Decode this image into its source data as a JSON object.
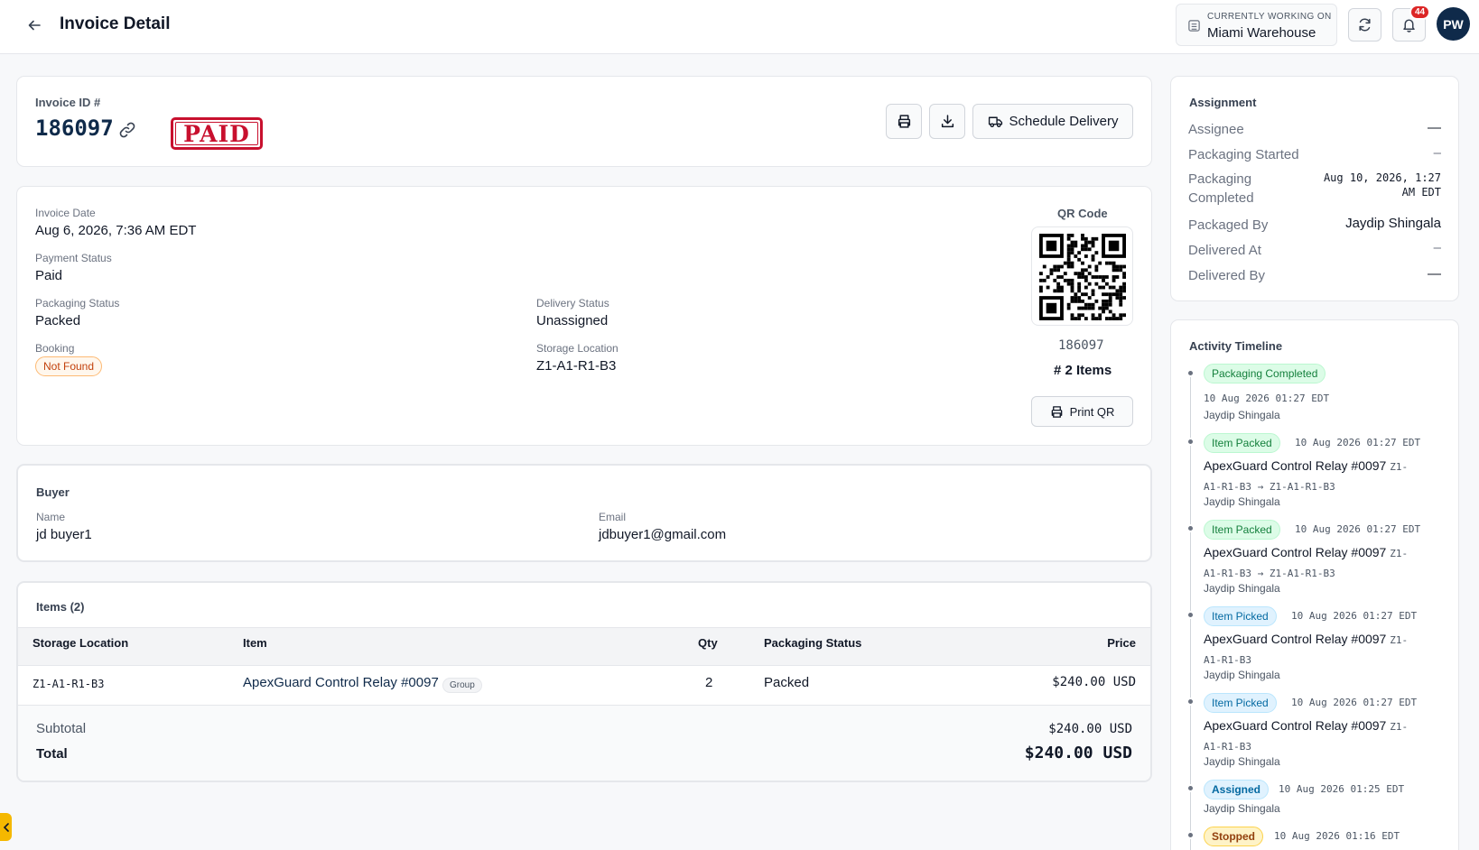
{
  "header": {
    "title": "Invoice Detail",
    "working_on_label": "CURRENTLY WORKING ON",
    "warehouse": "Miami Warehouse",
    "notif_count": "44",
    "avatar_initials": "PW"
  },
  "invoice": {
    "id_label": "Invoice ID #",
    "id": "186097",
    "stamp": "PAID",
    "schedule_delivery": "Schedule Delivery"
  },
  "details": {
    "invoice_date_label": "Invoice Date",
    "invoice_date": "Aug 6, 2026, 7:36 AM EDT",
    "payment_status_label": "Payment Status",
    "payment_status": "Paid",
    "packaging_status_label": "Packaging Status",
    "packaging_status": "Packed",
    "delivery_status_label": "Delivery Status",
    "delivery_status": "Unassigned",
    "booking_label": "Booking",
    "booking": "Not Found",
    "storage_location_label": "Storage Location",
    "storage_location": "Z1-A1-R1-B3",
    "qr_label": "QR Code",
    "qr_id": "186097",
    "items_count": "# 2 Items",
    "print_qr": "Print QR"
  },
  "buyer": {
    "title": "Buyer",
    "name_label": "Name",
    "name": "jd buyer1",
    "email_label": "Email",
    "email": "jdbuyer1@gmail.com"
  },
  "items": {
    "title": "Items (2)",
    "columns": [
      "Storage Location",
      "Item",
      "Qty",
      "Packaging Status",
      "Price"
    ],
    "rows": [
      {
        "location": "Z1-A1-R1-B3",
        "item": "ApexGuard Control Relay #0097",
        "tag": "Group",
        "qty": "2",
        "status": "Packed",
        "price": "$240.00 USD"
      }
    ],
    "subtotal_label": "Subtotal",
    "subtotal": "$240.00 USD",
    "total_label": "Total",
    "total": "$240.00 USD"
  },
  "assignment": {
    "title": "Assignment",
    "assignee_label": "Assignee",
    "assignee": "—",
    "pkg_started_label": "Packaging Started",
    "pkg_started": "–",
    "pkg_completed_label": "Packaging Completed",
    "pkg_completed_line1": "Aug 10, 2026, 1:27",
    "pkg_completed_line2": "AM EDT",
    "packaged_by_label": "Packaged By",
    "packaged_by": "Jaydip Shingala",
    "delivered_at_label": "Delivered At",
    "delivered_at": "–",
    "delivered_by_label": "Delivered By",
    "delivered_by": "—"
  },
  "timeline": {
    "title": "Activity Timeline",
    "events": [
      {
        "badge": "Packaging Completed",
        "time": "10 Aug 2026 01:27 EDT",
        "user": "Jaydip Shingala"
      },
      {
        "badge": "Item Packed",
        "time": "10 Aug 2026 01:27 EDT",
        "item": "ApexGuard Control Relay #0097",
        "loc1": "Z1-",
        "loc2": "A1-R1-B3 → Z1-A1-R1-B3",
        "user": "Jaydip Shingala"
      },
      {
        "badge": "Item Packed",
        "time": "10 Aug 2026 01:27 EDT",
        "item": "ApexGuard Control Relay #0097",
        "loc1": "Z1-",
        "loc2": "A1-R1-B3 → Z1-A1-R1-B3",
        "user": "Jaydip Shingala"
      },
      {
        "badge": "Item Picked",
        "time": "10 Aug 2026 01:27 EDT",
        "item": "ApexGuard Control Relay #0097",
        "loc1": "Z1-",
        "loc2": "A1-R1-B3",
        "user": "Jaydip Shingala"
      },
      {
        "badge": "Item Picked",
        "time": "10 Aug 2026 01:27 EDT",
        "item": "ApexGuard Control Relay #0097",
        "loc1": "Z1-",
        "loc2": "A1-R1-B3",
        "user": "Jaydip Shingala"
      },
      {
        "badge": "Assigned",
        "time": "10 Aug 2026 01:25 EDT",
        "user": "Jaydip Shingala"
      },
      {
        "badge": "Stopped",
        "time": "10 Aug 2026 01:16 EDT"
      }
    ]
  },
  "icons": {
    "back": "arrow-left-icon",
    "link": "link-icon",
    "print": "printer-icon",
    "download": "download-icon",
    "truck": "truck-icon",
    "refresh": "refresh-icon",
    "bell": "bell-icon",
    "building": "building-icon",
    "collapse": "chevron-left-icon"
  }
}
